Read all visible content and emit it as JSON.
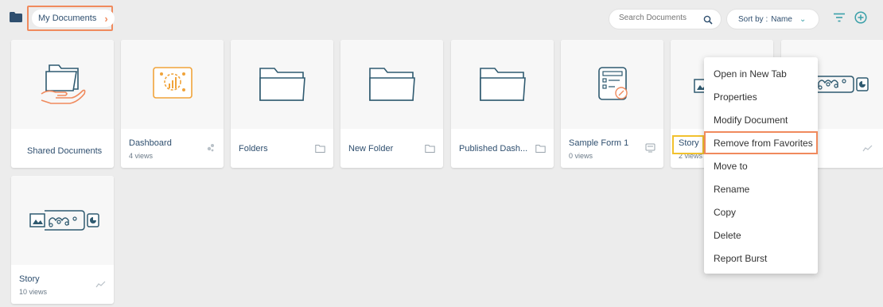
{
  "header": {
    "breadcrumb": "My Documents",
    "search_placeholder": "Search Documents",
    "sort_label": "Sort by :",
    "sort_value": "Name"
  },
  "cards": [
    {
      "title": "Shared Documents",
      "sub": "",
      "icon": "shared-folder-hand-icon"
    },
    {
      "title": "Dashboard",
      "sub": "4 views",
      "icon": "dashboard-icon"
    },
    {
      "title": "Folders",
      "sub": "",
      "icon": "folder-icon"
    },
    {
      "title": "New Folder",
      "sub": "",
      "icon": "folder-icon"
    },
    {
      "title": "Published Dash...",
      "sub": "",
      "icon": "folder-icon"
    },
    {
      "title": "Sample Form 1",
      "sub": "0 views",
      "icon": "form-icon"
    },
    {
      "title": "Story",
      "sub": "2 views",
      "icon": "story-icon"
    },
    {
      "title": "",
      "sub": "",
      "icon": "story-icon"
    },
    {
      "title": "Story",
      "sub": "10 views",
      "icon": "story-icon"
    }
  ],
  "context_menu": {
    "items": [
      "Open in New Tab",
      "Properties",
      "Modify Document",
      "Remove from Favorites",
      "Move to",
      "Rename",
      "Copy",
      "Delete",
      "Report Burst"
    ]
  },
  "colors": {
    "accent_orange": "#f08a5d",
    "highlight_yellow": "#f2c12e",
    "teal": "#3aa0a9",
    "navy": "#2f4f6f"
  }
}
